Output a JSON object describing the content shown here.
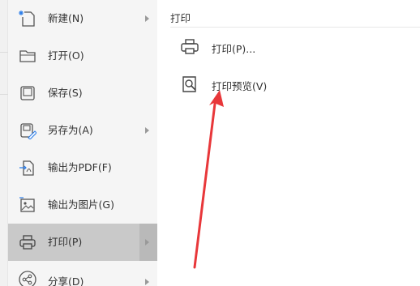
{
  "menu": {
    "items": [
      {
        "label": "新建(N)",
        "icon": "new-file-icon",
        "has_submenu": true
      },
      {
        "label": "打开(O)",
        "icon": "folder-open-icon",
        "has_submenu": false
      },
      {
        "label": "保存(S)",
        "icon": "save-icon",
        "has_submenu": false
      },
      {
        "label": "另存为(A)",
        "icon": "save-as-icon",
        "has_submenu": true
      },
      {
        "label": "输出为PDF(F)",
        "icon": "export-pdf-icon",
        "has_submenu": false
      },
      {
        "label": "输出为图片(G)",
        "icon": "export-image-icon",
        "has_submenu": false
      },
      {
        "label": "打印(P)",
        "icon": "printer-icon",
        "has_submenu": true,
        "active": true
      },
      {
        "label": "分享(D)",
        "icon": "share-icon",
        "has_submenu": true
      }
    ]
  },
  "submenu": {
    "title": "打印",
    "items": [
      {
        "label": "打印(P)...",
        "icon": "printer-icon"
      },
      {
        "label": "打印预览(V)",
        "icon": "print-preview-icon"
      }
    ]
  },
  "annotation": {
    "color": "#e8373a",
    "icon": "red-arrow-icon"
  }
}
